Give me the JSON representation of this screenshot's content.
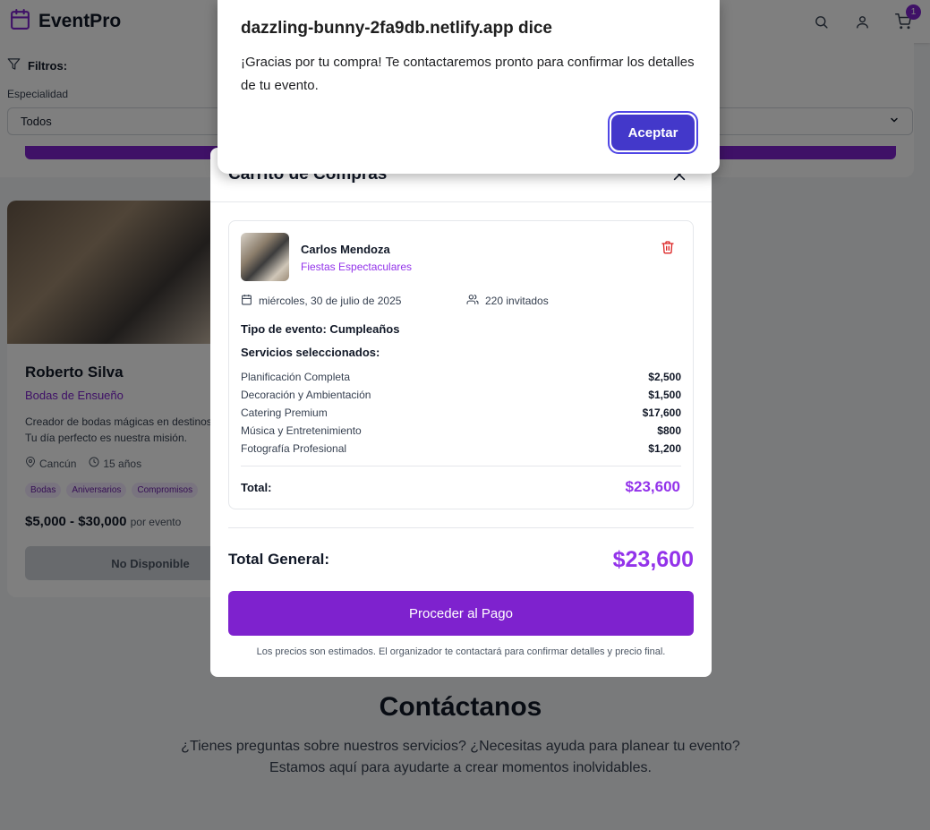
{
  "header": {
    "brand": "EventPro",
    "cart_count": "1"
  },
  "filters": {
    "title": "Filtros:",
    "specialty_label": "Especialidad",
    "specialty_value": "Todos"
  },
  "card": {
    "name": "Roberto Silva",
    "company": "Bodas de Ensueño",
    "description_line1": "Creador de bodas mágicas en destinos p",
    "description_line2": "Tu día perfecto es nuestra misión.",
    "location": "Cancún",
    "experience": "15 años",
    "tags": [
      "Bodas",
      "Aniversarios",
      "Compromisos"
    ],
    "price_range": "$5,000 - $30,000",
    "price_unit": "por evento",
    "button_label": "No Disponible"
  },
  "contact": {
    "title": "Contáctanos",
    "line1": "¿Tienes preguntas sobre nuestros servicios? ¿Necesitas ayuda para planear tu evento?",
    "line2": "Estamos aquí para ayudarte a crear momentos inolvidables."
  },
  "cart": {
    "title": "Carrito de Compras",
    "item": {
      "name": "Carlos Mendoza",
      "company": "Fiestas Espectaculares",
      "date": "miércoles, 30 de julio de 2025",
      "guests": "220 invitados",
      "event_type": "Tipo de evento: Cumpleaños",
      "services_label": "Servicios seleccionados:",
      "services": [
        {
          "name": "Planificación Completa",
          "price": "$2,500"
        },
        {
          "name": "Decoración y Ambientación",
          "price": "$1,500"
        },
        {
          "name": "Catering Premium",
          "price": "$17,600"
        },
        {
          "name": "Música y Entretenimiento",
          "price": "$800"
        },
        {
          "name": "Fotografía Profesional",
          "price": "$1,200"
        }
      ],
      "total_label": "Total:",
      "total_value": "$23,600"
    },
    "grand_total_label": "Total General:",
    "grand_total_value": "$23,600",
    "pay_button": "Proceder al Pago",
    "disclaimer": "Los precios son estimados. El organizador te contactará para confirmar detalles y precio final."
  },
  "alert": {
    "title": "dazzling-bunny-2fa9db.netlify.app dice",
    "message": "¡Gracias por tu compra! Te contactaremos pronto para confirmar los detalles de tu evento.",
    "button": "Aceptar"
  },
  "colors": {
    "accent": "#7e22ce",
    "accent_text": "#9333ea",
    "alert_button": "#4338ca"
  }
}
